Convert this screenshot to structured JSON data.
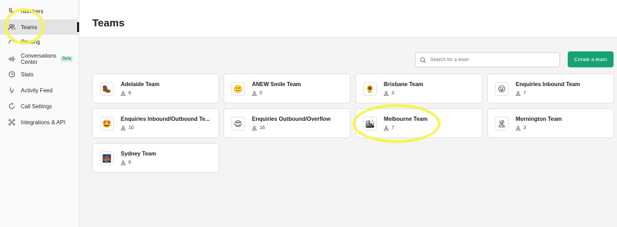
{
  "sidebar": {
    "items": [
      {
        "label": "Numbers",
        "icon": "phone-icon"
      },
      {
        "label": "Teams",
        "icon": "teams-icon",
        "active": true
      },
      {
        "label": "Routing",
        "icon": "routing-icon"
      },
      {
        "label": "Conversations Center",
        "icon": "waveform-icon",
        "badge": "Beta"
      },
      {
        "label": "Stats",
        "icon": "clock-icon"
      },
      {
        "label": "Activity Feed",
        "icon": "activity-icon"
      },
      {
        "label": "Call Settings",
        "icon": "call-settings-icon"
      },
      {
        "label": "Integrations & API",
        "icon": "integrations-icon"
      }
    ],
    "conversations_line1": "Conversations",
    "conversations_line2": "Center"
  },
  "header": {
    "title": "Teams"
  },
  "search": {
    "placeholder": "Search for a team"
  },
  "create_button": {
    "label": "Create a team"
  },
  "teams": [
    {
      "name": "Adelaide Team",
      "members": "6",
      "emoji": "🥾"
    },
    {
      "name": "ANEW Smile Team",
      "members": "5",
      "emoji": "🙂"
    },
    {
      "name": "Brisbane Team",
      "members": "3",
      "emoji": "🌻"
    },
    {
      "name": "Enquiries Inbound Team",
      "members": "7",
      "emoji": "😜"
    },
    {
      "name": "Enquiries Inbound/Outbound Te...",
      "members": "10",
      "emoji": "🤩"
    },
    {
      "name": "Enquiries Outbound/Overflow",
      "members": "16",
      "emoji": "😍"
    },
    {
      "name": "Melbourne Team",
      "members": "7",
      "emoji": "🏙"
    },
    {
      "name": "Mornington Team",
      "members": "3",
      "emoji": "🏝"
    },
    {
      "name": "Sydney Team",
      "members": "6",
      "emoji": "🌉"
    }
  ],
  "colors": {
    "accent": "#16a374",
    "highlight": "#f5f542",
    "beta_bg": "#cdeee0"
  }
}
